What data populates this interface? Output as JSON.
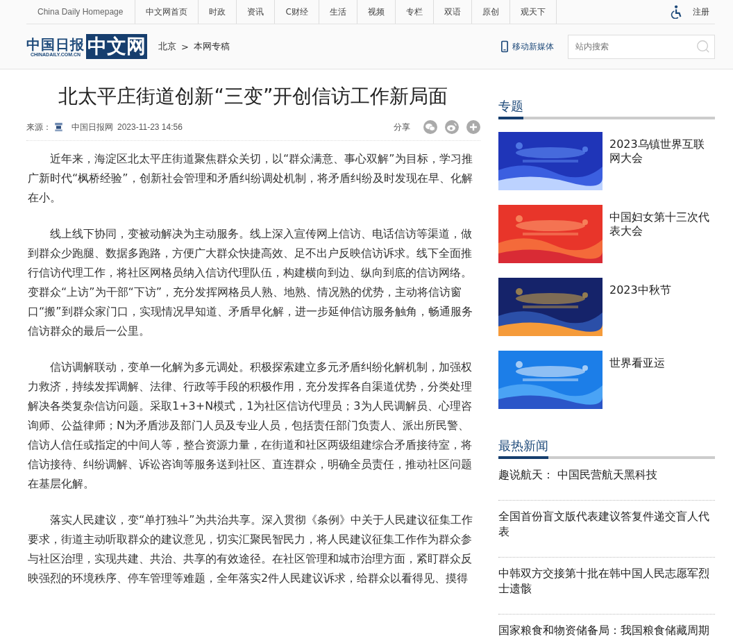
{
  "top_nav": {
    "items": [
      {
        "label": "China Daily Homepage"
      },
      {
        "label": "中文网首页"
      },
      {
        "label": "时政"
      },
      {
        "label": "资讯"
      },
      {
        "label": "C财经"
      },
      {
        "label": "生活"
      },
      {
        "label": "视频"
      },
      {
        "label": "专栏"
      },
      {
        "label": "双语"
      },
      {
        "label": "原创"
      },
      {
        "label": "观天下"
      }
    ],
    "register": "注册"
  },
  "header": {
    "logo": {
      "calligraphy": "中国日报",
      "domain": "CHINADAILY.COM.CN",
      "site": "中文网"
    },
    "breadcrumb": [
      {
        "label": "北京"
      },
      {
        "label": "本网专稿"
      }
    ],
    "separator": ">",
    "mobile_link": "移动新媒体",
    "search": {
      "placeholder": "站内搜索"
    }
  },
  "article": {
    "title": "北太平庄街道创新“三变”开创信访工作新局面",
    "source_label": "来源：",
    "source": "中国日报网",
    "datetime": "2023-11-23 14:56",
    "share_label": "分享",
    "paragraphs": [
      "近年来，海淀区北太平庄街道聚焦群众关切，以“群众满意、事心双解”为目标，学习推广新时代“枫桥经验”，创新社会管理和矛盾纠纷调处机制，将矛盾纠纷及时发现在早、化解在小。",
      "线上线下协同，变被动解决为主动服务。线上深入宣传网上信访、电话信访等渠道，做到群众少跑腿、数据多跑路，方便广大群众快捷高效、足不出户反映信访诉求。线下全面推行信访代理工作，将社区网格员纳入信访代理队伍，构建横向到边、纵向到底的信访网络。变群众“上访”为干部“下访”，充分发挥网格员人熟、地熟、情况熟的优势，主动将信访窗口“搬”到群众家门口，实现情况早知道、矛盾早化解，进一步延伸信访服务触角，畅通服务信访群众的最后一公里。",
      "信访调解联动，变单一化解为多元调处。积极探索建立多元矛盾纠纷化解机制，加强权力救济，持续发挥调解、法律、行政等手段的积极作用，充分发挥各自渠道优势，分类处理解决各类复杂信访问题。采取1+3+N模式，1为社区信访代理员；3为人民调解员、心理咨询师、公益律师；N为矛盾涉及部门人员及专业人员，包括责任部门负责人、派出所民警、信访人信任或指定的中间人等，整合资源力量，在街道和社区两级组建综合矛盾接待室，将信访接待、纠纷调解、诉讼咨询等服务送到社区、直连群众，明确全员责任，推动社区问题在基层化解。",
      "落实人民建议，变“单打独斗”为共治共享。深入贯彻《条例》中关于人民建议征集工作要求，街道主动听取群众的建议意见，切实汇聚民智民力，将人民建议征集工作作为群众参与社区治理，实现共建、共治、共享的有效途径。在社区管理和城市治理方面，紧盯群众反映强烈的环境秩序、停车管理等难题，全年落实2件人民建议诉求，给群众以看得见、摸得"
    ]
  },
  "sidebar": {
    "topics_title": "专题",
    "topics": [
      {
        "title": "2023乌镇世界互联网大会",
        "kind": "picture"
      },
      {
        "title": "中国妇女第十三次代表大会",
        "kind": "picture"
      },
      {
        "title": "2023中秋节",
        "kind": "picture"
      },
      {
        "title": "世界看亚运",
        "kind": "picture"
      }
    ],
    "hot_title": "最热新闻",
    "hot_news": [
      {
        "title": "趣说航天： 中国民营航天黑科技"
      },
      {
        "title": "全国首份盲文版代表建议答复件递交盲人代表"
      },
      {
        "title": "中韩双方交接第十批在韩中国人民志愿军烈士遗骸"
      },
      {
        "title": "国家粮食和物资储备局：我国粮食储藏周期"
      }
    ]
  }
}
